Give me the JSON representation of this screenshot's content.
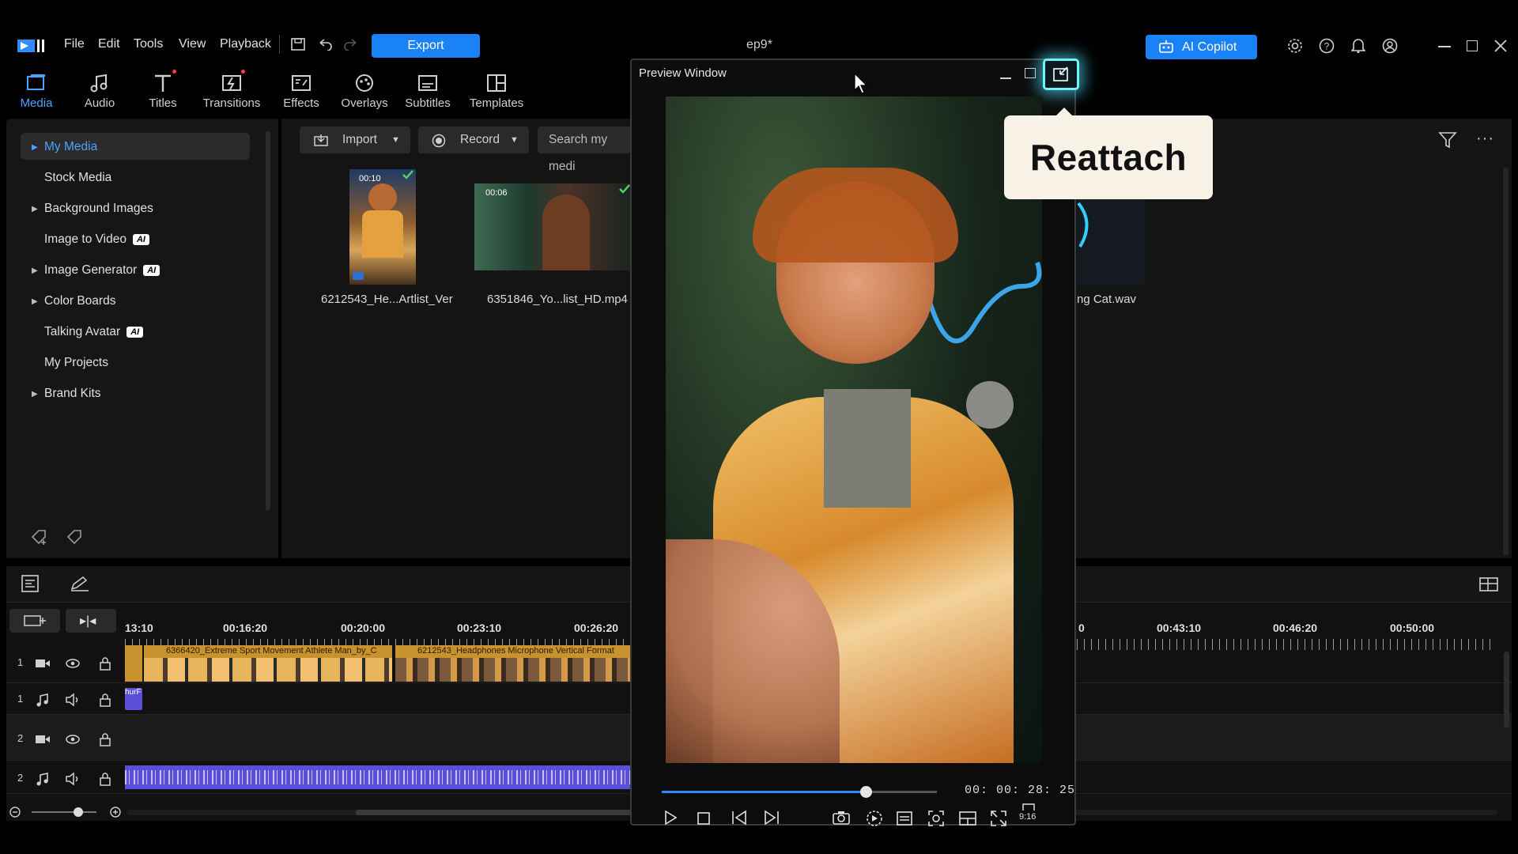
{
  "menu": {
    "file": "File",
    "edit": "Edit",
    "tools": "Tools",
    "view": "View",
    "playback": "Playback",
    "export": "Export",
    "project_title": "ep9*",
    "ai_copilot": "AI Copilot"
  },
  "tabs": [
    {
      "label": "Media",
      "icon": "media-icon"
    },
    {
      "label": "Audio",
      "icon": "music-note-icon"
    },
    {
      "label": "Titles",
      "icon": "title-t-icon"
    },
    {
      "label": "Transitions",
      "icon": "transition-icon"
    },
    {
      "label": "Effects",
      "icon": "effects-icon"
    },
    {
      "label": "Overlays",
      "icon": "overlays-icon"
    },
    {
      "label": "Subtitles",
      "icon": "subtitles-icon"
    },
    {
      "label": "Templates",
      "icon": "templates-icon"
    }
  ],
  "sidebar": {
    "items": [
      {
        "label": "My Media",
        "arrow": true,
        "ai": false
      },
      {
        "label": "Stock Media",
        "arrow": false,
        "ai": false
      },
      {
        "label": "Background Images",
        "arrow": true,
        "ai": false
      },
      {
        "label": "Image to Video",
        "arrow": false,
        "ai": true
      },
      {
        "label": "Image Generator",
        "arrow": true,
        "ai": true
      },
      {
        "label": "Color Boards",
        "arrow": true,
        "ai": false
      },
      {
        "label": "Talking Avatar",
        "arrow": false,
        "ai": true
      },
      {
        "label": "My Projects",
        "arrow": false,
        "ai": false
      },
      {
        "label": "Brand Kits",
        "arrow": true,
        "ai": false
      }
    ],
    "ai_badge": "AI"
  },
  "library": {
    "import": "Import",
    "record": "Record",
    "search_placeholder": "Search my medi",
    "items": [
      {
        "name": "6212543_He...Artlist_Ver",
        "duration": "00:10"
      },
      {
        "name": "6351846_Yo...list_HD.mp4",
        "duration": "00:06"
      },
      {
        "name": "ng Cat.wav",
        "duration": ""
      }
    ]
  },
  "preview": {
    "title": "Preview Window",
    "tooltip": "Reattach",
    "timecode": "00: 00: 28: 25",
    "progress": 0.74,
    "aspect": "9:16"
  },
  "timeline": {
    "ticks": [
      "13:10",
      "00:16:20",
      "00:20:00",
      "00:23:10",
      "00:26:20",
      "0",
      "00:43:10",
      "00:46:20",
      "00:50:00"
    ],
    "clip1": "6366420_Extreme Sport Movement Athlete Man_by_C",
    "clip2": "6212543_Headphones Microphone Vertical Format",
    "audio_clip": "hurF",
    "tracks": [
      {
        "num": "1",
        "type": "video"
      },
      {
        "num": "1",
        "type": "audio"
      },
      {
        "num": "2",
        "type": "video"
      },
      {
        "num": "2",
        "type": "audio"
      }
    ]
  },
  "colors": {
    "accent": "#1a82f7",
    "active_tab": "#4aa3ff",
    "glow": "#6ff3ff",
    "video_clip": "#c8922e",
    "audio_clip": "#5a4fd6"
  }
}
